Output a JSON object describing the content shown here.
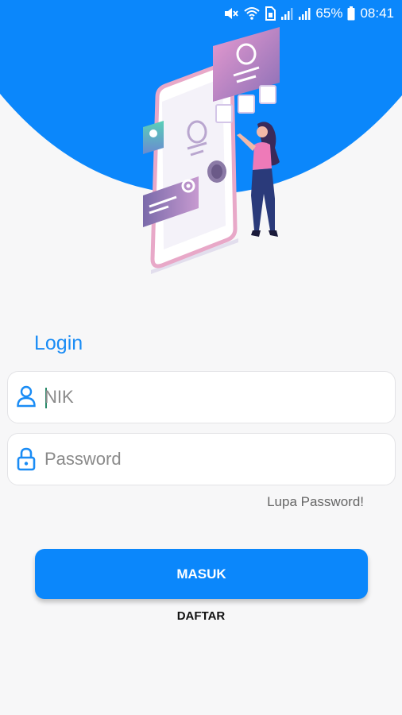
{
  "status_bar": {
    "battery_percent": "65%",
    "time": "08:41",
    "icons": [
      "mute-icon",
      "wifi-icon",
      "sim-icon",
      "signal-icon",
      "signal-icon",
      "battery-icon"
    ]
  },
  "login": {
    "title": "Login",
    "nik_placeholder": "NIK",
    "nik_value": "",
    "password_placeholder": "Password",
    "password_value": "",
    "forgot_label": "Lupa Password!",
    "submit_label": "MASUK",
    "register_label": "DAFTAR"
  },
  "colors": {
    "primary": "#0b87fb",
    "title": "#1a8cf5",
    "background": "#f7f7f8"
  }
}
